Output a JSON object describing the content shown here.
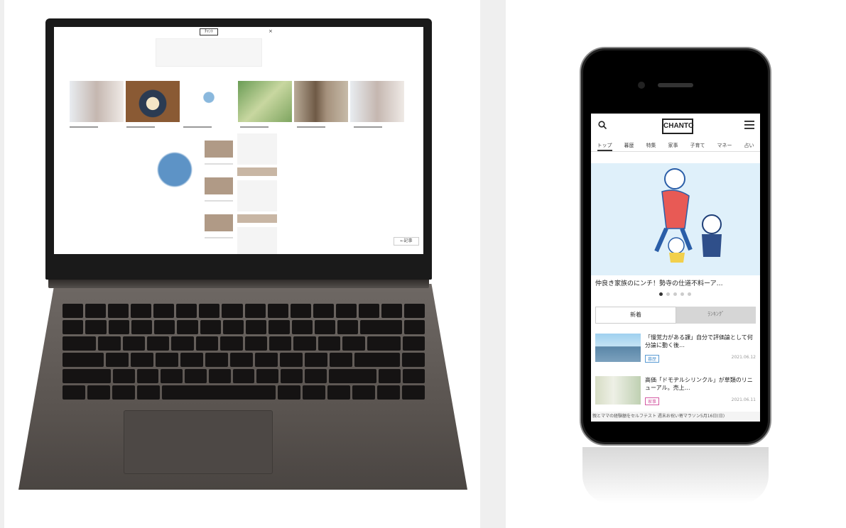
{
  "laptop": {
    "screen": {
      "logo_text": "ﾁｬﾝﾄ",
      "close_glyph": "×",
      "corner_badge": "←記事"
    }
  },
  "phone": {
    "logo_text": "CHANTO",
    "nav": [
      "トップ",
      "暮歴",
      "特集",
      "家事",
      "子育て",
      "マネー",
      "占い"
    ],
    "hero_title": "仲良き家族のにンチ！勢寺の仕道不料ーア…",
    "tabs": {
      "new": "新着",
      "ranking": "ﾗﾝｷﾝｸﾞ"
    },
    "articles": [
      {
        "title": "「慢覚力がある課」自分で評価論として何分論に動く後…",
        "tag": "暮歴",
        "date": "2021.06.12"
      },
      {
        "title": "高価「ドモヂルシリンクル」が草類のリニューアル。売上…",
        "tag": "家事",
        "date": "2021.06.11"
      }
    ],
    "ticker": "親とママの経験額をセルフテスト 週末お祝い寄マラソン5月16日(日)"
  },
  "colors": {
    "phone_hero_bg": "#dff0fa",
    "tag_blue": "#5a9bd4",
    "tag_pink": "#d45aa3"
  }
}
